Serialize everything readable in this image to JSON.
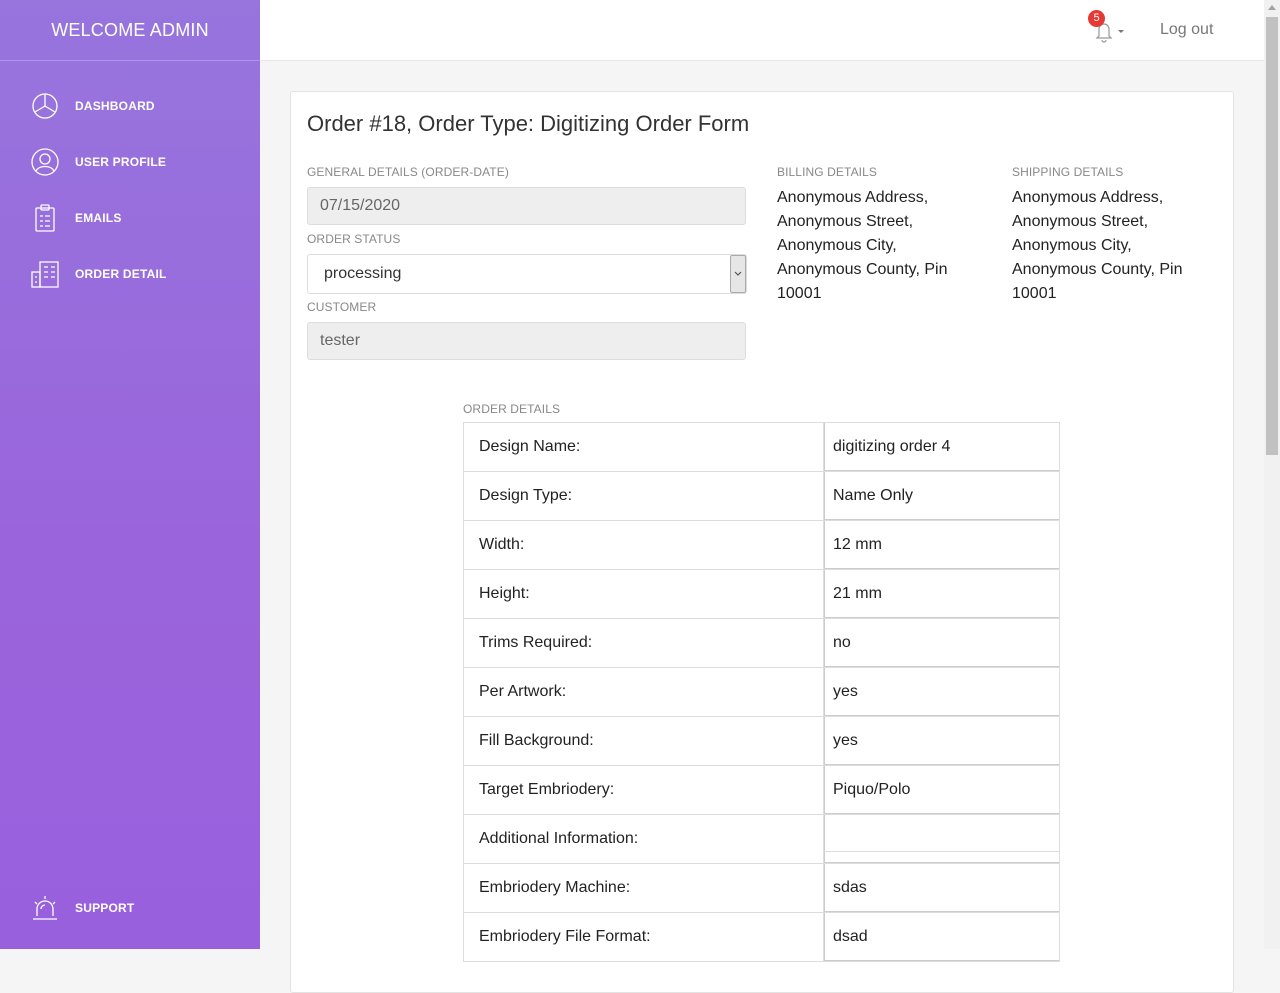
{
  "sidebar": {
    "brand": "WELCOME ADMIN",
    "items": [
      {
        "label": "DASHBOARD",
        "icon": "pie-chart-icon"
      },
      {
        "label": "USER PROFILE",
        "icon": "user-icon"
      },
      {
        "label": "EMAILS",
        "icon": "clipboard-icon"
      },
      {
        "label": "ORDER DETAIL",
        "icon": "building-icon"
      }
    ],
    "support": {
      "label": "SUPPORT",
      "icon": "siren-icon"
    }
  },
  "topbar": {
    "notification_count": "5",
    "logout_label": "Log out"
  },
  "order": {
    "title": "Order #18, Order Type: Digitizing Order Form",
    "general_label": "GENERAL DETAILS (ORDER-DATE)",
    "order_date": "07/15/2020",
    "status_label": "ORDER STATUS",
    "status_value": "processing",
    "customer_label": "CUSTOMER",
    "customer_value": "tester",
    "billing_label": "BILLING DETAILS",
    "billing_lines": [
      "Anonymous Address,",
      "Anonymous Street,",
      "Anonymous City,",
      "Anonymous County, Pin",
      "10001"
    ],
    "shipping_label": "SHIPPING DETAILS",
    "shipping_lines": [
      "Anonymous Address,",
      "Anonymous Street,",
      "Anonymous City,",
      "Anonymous County, Pin",
      "10001"
    ],
    "details_label": "ORDER DETAILS",
    "details": [
      {
        "key": "Design Name:",
        "value": "digitizing order 4"
      },
      {
        "key": "Design Type:",
        "value": "Name Only"
      },
      {
        "key": "Width:",
        "value": "12 mm"
      },
      {
        "key": "Height:",
        "value": "21 mm"
      },
      {
        "key": "Trims Required:",
        "value": "no"
      },
      {
        "key": "Per Artwork:",
        "value": "yes"
      },
      {
        "key": "Fill Background:",
        "value": "yes"
      },
      {
        "key": "Target Embriodery:",
        "value": "Piquo/Polo"
      },
      {
        "key": "Additional Information:",
        "value": ""
      },
      {
        "key": "Embriodery Machine:",
        "value": "sdas"
      },
      {
        "key": "Embriodery File Format:",
        "value": "dsad"
      }
    ]
  },
  "colors": {
    "sidebar_top": "#9775dd",
    "sidebar_bottom": "#9960de",
    "badge": "#e53935"
  }
}
